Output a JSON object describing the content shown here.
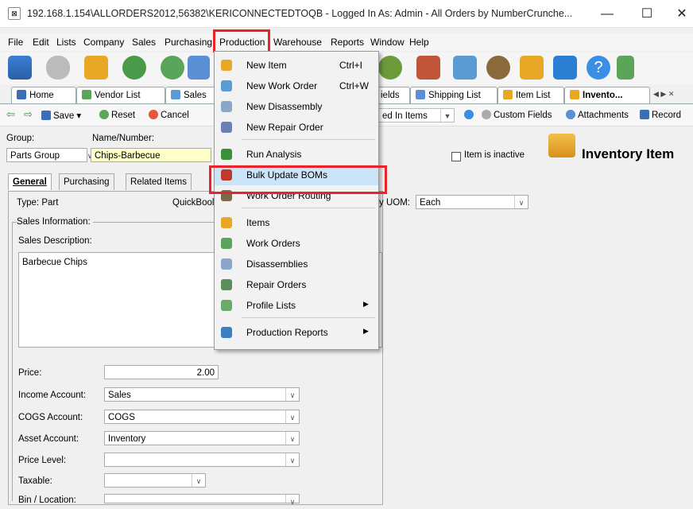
{
  "window": {
    "title": "192.168.1.154\\ALLORDERS2012,56382\\KERICONNECTEDTOQB - Logged In As: Admin - All Orders by NumberCrunche...",
    "minimize": "—",
    "maximize": "☐",
    "close": "✕"
  },
  "menubar": [
    "File",
    "Edit",
    "Lists",
    "Company",
    "Sales",
    "Purchasing",
    "Production",
    "Warehouse",
    "Reports",
    "Window",
    "Help"
  ],
  "tabs": [
    "Home",
    "Vendor List",
    "Sales",
    "ields",
    "Shipping List",
    "Item List",
    "Invento..."
  ],
  "tab_nav": "◀ ▶ ✕",
  "subtoolbar": {
    "save": "Save ▾",
    "reset": "Reset",
    "cancel": "Cancel",
    "in_items": "ed In Items",
    "custom_fields": "Custom Fields",
    "attachments": "Attachments",
    "record": "Record"
  },
  "header": {
    "group_label": "Group:",
    "name_label": "Name/Number:",
    "group_value": "Parts Group",
    "name_value": "Chips-Barbecue",
    "inactive_label": "Item is inactive",
    "form_title": "Inventory Item"
  },
  "inner_tabs": [
    "General",
    "Purchasing",
    "Related Items"
  ],
  "form": {
    "type_label": "Type: Part",
    "quickbooks_label": "QuickBool",
    "uom_label": "y UOM:",
    "uom_value": "Each",
    "sales_info": "Sales Information:",
    "sales_desc_label": "Sales Description:",
    "sales_desc_value": "Barbecue Chips",
    "price_label": "Price:",
    "price_value": "2.00",
    "income_label": "Income Account:",
    "income_value": "Sales",
    "cogs_label": "COGS Account:",
    "cogs_value": "COGS",
    "asset_label": "Asset Account:",
    "asset_value": "Inventory",
    "pricelevel_label": "Price Level:",
    "pricelevel_value": "",
    "taxable_label": "Taxable:",
    "taxable_value": "",
    "bin_label": "Bin / Location:"
  },
  "production_menu": [
    {
      "label": "New Item",
      "shortcut": "Ctrl+I",
      "icon": "new-item-icon",
      "color": "#e8a826"
    },
    {
      "label": "New Work Order",
      "shortcut": "Ctrl+W",
      "icon": "work-order-icon",
      "color": "#5a9bd5"
    },
    {
      "label": "New Disassembly",
      "shortcut": "",
      "icon": "disassembly-icon",
      "color": "#8aa6c8"
    },
    {
      "label": "New Repair Order",
      "shortcut": "",
      "icon": "repair-order-icon",
      "color": "#6a7fb5"
    },
    {
      "label": "Run Analysis",
      "shortcut": "",
      "icon": "analysis-icon",
      "color": "#3a8f3a"
    },
    {
      "label": "Bulk Update BOMs",
      "shortcut": "",
      "icon": "bulk-update-icon",
      "color": "#c0392b"
    },
    {
      "label": "Work Order Routing",
      "shortcut": "",
      "icon": "routing-icon",
      "color": "#7a6a4a"
    },
    {
      "label": "Items",
      "shortcut": "",
      "icon": "items-icon",
      "color": "#e8a826"
    },
    {
      "label": "Work Orders",
      "shortcut": "",
      "icon": "work-orders-icon",
      "color": "#5aa55a"
    },
    {
      "label": "Disassemblies",
      "shortcut": "",
      "icon": "disassemblies-icon",
      "color": "#8aa6c8"
    },
    {
      "label": "Repair Orders",
      "shortcut": "",
      "icon": "repair-orders-icon",
      "color": "#5a8f5a"
    },
    {
      "label": "Profile Lists",
      "shortcut": "",
      "icon": "profile-lists-icon",
      "color": "#6aaa6a"
    },
    {
      "label": "Production Reports",
      "shortcut": "",
      "icon": "reports-icon",
      "color": "#3a7fc0"
    }
  ],
  "colors": {
    "highlight_box": "#e8232a",
    "menu_hover": "#cce4f7"
  }
}
